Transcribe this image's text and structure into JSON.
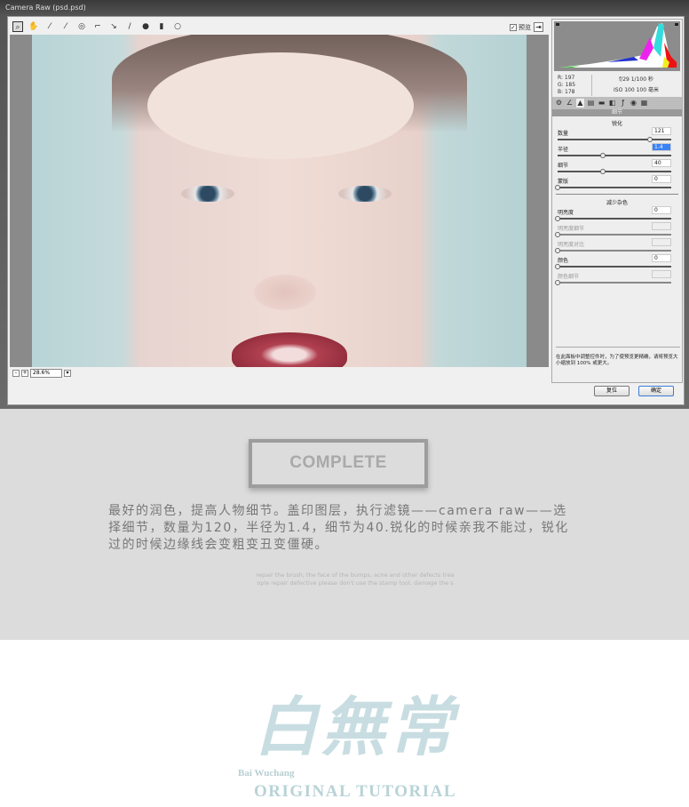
{
  "window": {
    "title": "Camera Raw (psd.psd)"
  },
  "toolbar": {
    "tools": [
      "zoom-tool",
      "hand-tool",
      "white-balance-tool",
      "color-sampler-tool",
      "target-adjust-tool",
      "crop-tool",
      "straighten-tool",
      "spot-removal-tool",
      "red-eye-tool",
      "adjustment-brush",
      "graduated-filter"
    ],
    "preview_label": "预览",
    "preview_checked": true
  },
  "statusbar": {
    "zoom": "28.6%"
  },
  "panel": {
    "info": {
      "r": "R:  197",
      "g": "G:  185",
      "b": "B:  178",
      "aperture_shutter": "f/29   1/100 秒",
      "iso_focal": "ISO 100   100 毫米"
    },
    "section_title": "细节",
    "sharpening": {
      "title": "锐化",
      "rows": [
        {
          "label": "数量",
          "value": "121",
          "level": 0.81,
          "enabled": true
        },
        {
          "label": "半径",
          "value": "1.4",
          "level": 0.4,
          "enabled": true,
          "selected": true
        },
        {
          "label": "细节",
          "value": "40",
          "level": 0.4,
          "enabled": true
        },
        {
          "label": "蒙版",
          "value": "0",
          "level": 0,
          "enabled": true
        }
      ]
    },
    "noise": {
      "title": "减少杂色",
      "rows": [
        {
          "label": "明亮度",
          "value": "0",
          "level": 0,
          "enabled": true
        },
        {
          "label": "明亮度细节",
          "value": "",
          "level": 0,
          "enabled": false
        },
        {
          "label": "明亮度对比",
          "value": "",
          "level": 0,
          "enabled": false
        },
        {
          "label": "颜色",
          "value": "0",
          "level": 0,
          "enabled": true
        },
        {
          "label": "颜色细节",
          "value": "",
          "level": 0,
          "enabled": false
        }
      ]
    },
    "hint": "在此面板中调整控件时，为了使预览更精确，请将预览大小缩放到 100% 或更大。"
  },
  "buttons": {
    "reset": "复位",
    "ok": "确定"
  },
  "tutorial": {
    "badge": "COMPLETE",
    "description": "最好的润色，提高人物细节。盖印图层，执行滤镜——camera raw——选择细节，数量为120，半径为1.4，细节为40.锐化的时候亲我不能过，锐化过的时候边缘线会变粗变丑变僵硬。",
    "english_1": "repair the brush, the face of the bumps, acne and other defects trea",
    "english_2": "ople repair defective please don't use the stamp tool, damage the s"
  },
  "logo": {
    "chinese": "白無常",
    "pinyin": "Bai Wuchang",
    "tagline": "ORIGINAL TUTORIAL",
    "color": "#c8dde1"
  }
}
